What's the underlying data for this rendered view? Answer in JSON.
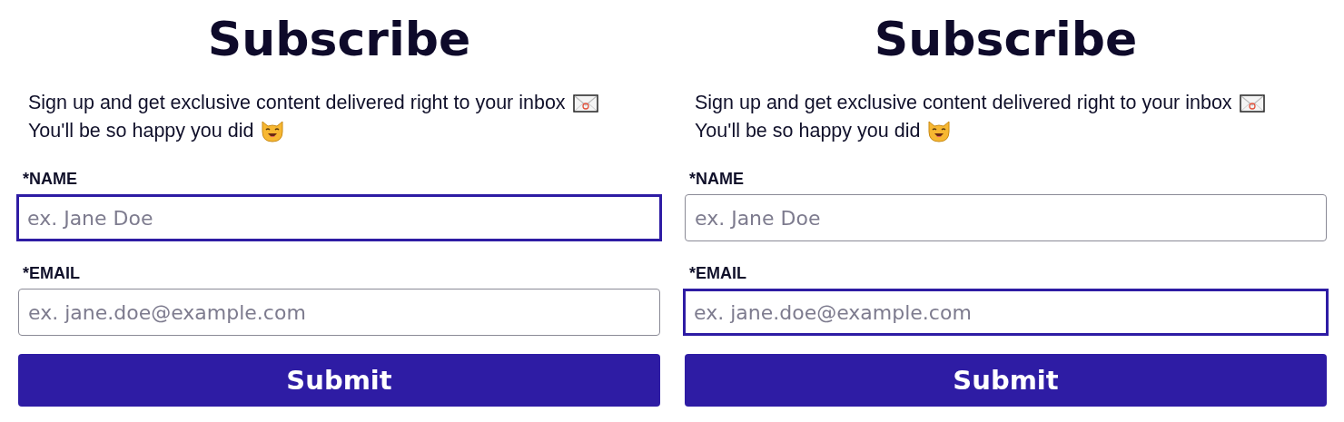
{
  "panels": [
    {
      "title": "Subscribe",
      "intro_lines": [
        "Sign up and get exclusive content delivered right to your inbox",
        "You'll be so happy you did"
      ],
      "fields": [
        {
          "label": "*NAME",
          "placeholder": "ex. Jane Doe",
          "focused": true
        },
        {
          "label": "*EMAIL",
          "placeholder": "ex. jane.doe@example.com",
          "focused": false
        }
      ],
      "button": "Submit"
    },
    {
      "title": "Subscribe",
      "intro_lines": [
        "Sign up and get exclusive content delivered right to your inbox",
        "You'll be so happy you did"
      ],
      "fields": [
        {
          "label": "*NAME",
          "placeholder": "ex. Jane Doe",
          "focused": false
        },
        {
          "label": "*EMAIL",
          "placeholder": "ex. jane.doe@example.com",
          "focused": true
        }
      ],
      "button": "Submit"
    }
  ]
}
